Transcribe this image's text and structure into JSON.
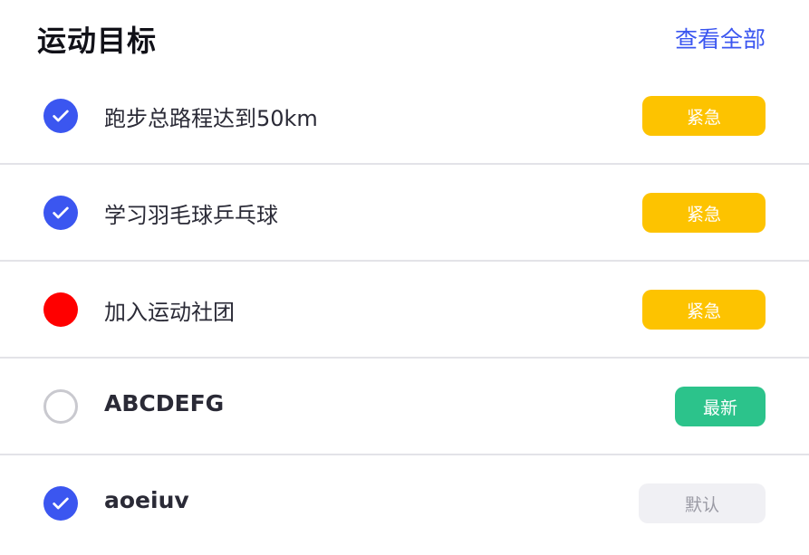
{
  "header": {
    "title": "运动目标",
    "view_all": "查看全部"
  },
  "colors": {
    "accent": "#3b56f0",
    "alert": "#ff0000",
    "urgent_tag": "#fdc300",
    "new_tag": "#2cc38b",
    "default_tag": "#f0f0f4"
  },
  "goals": [
    {
      "label": "跑步总路程达到50km",
      "status": "checked",
      "tag": "紧急"
    },
    {
      "label": "学习羽毛球乒乓球",
      "status": "checked",
      "tag": "紧急"
    },
    {
      "label": "加入运动社团",
      "status": "alert",
      "tag": "紧急"
    },
    {
      "label": "ABCDEFG",
      "status": "unchecked",
      "tag": "最新"
    },
    {
      "label": "aoeiuv",
      "status": "checked",
      "tag": "默认"
    }
  ]
}
